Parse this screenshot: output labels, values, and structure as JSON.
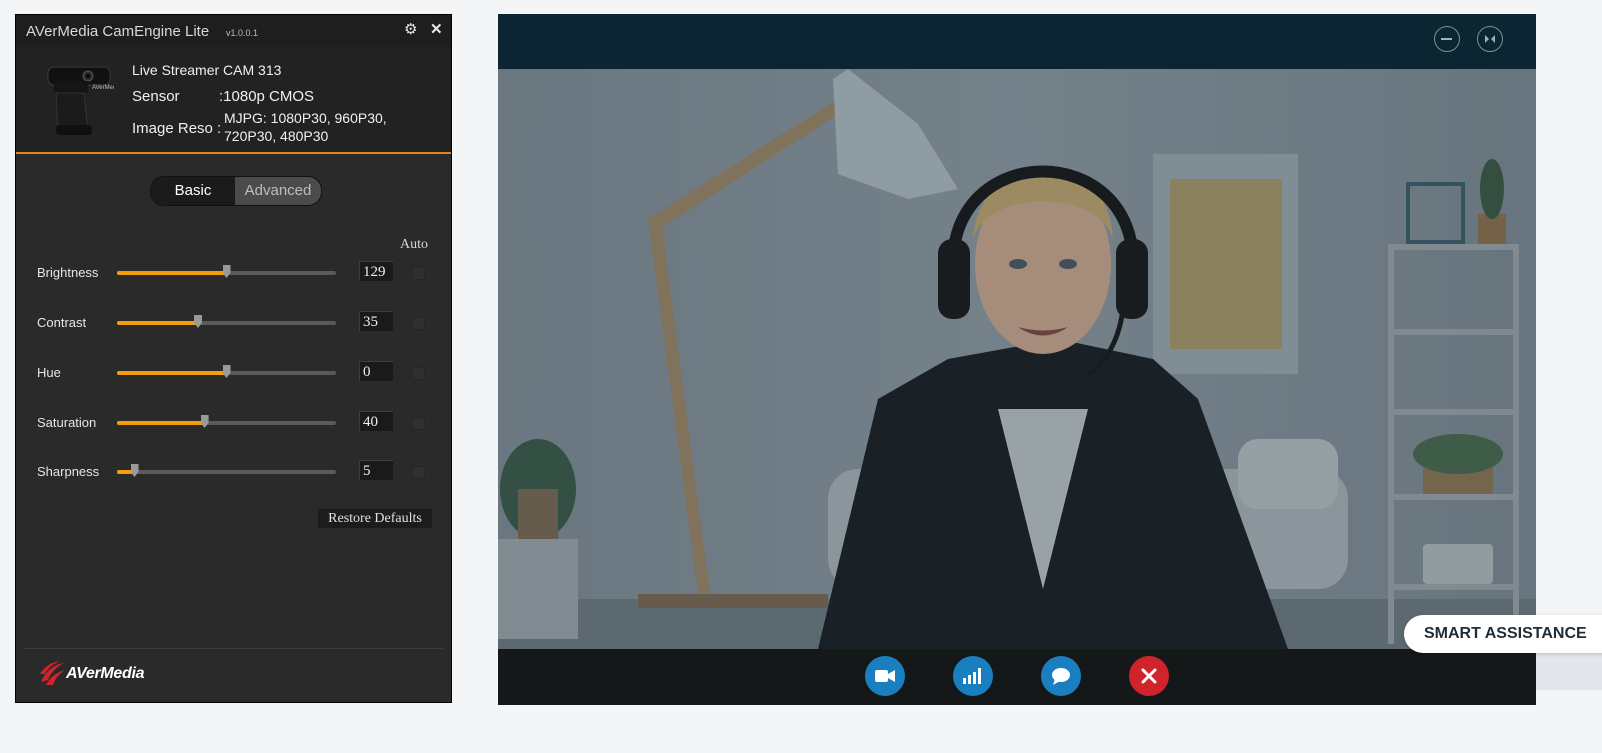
{
  "app": {
    "title": "AVerMedia CamEngine Lite",
    "version": "v1.0.0.1"
  },
  "device": {
    "name": "Live Streamer CAM 313",
    "sensor_label": "Sensor",
    "sensor_value": ":1080p CMOS",
    "reso_label": "Image Reso :",
    "reso_line1": "MJPG: 1080P30, 960P30,",
    "reso_line2": "720P30, 480P30"
  },
  "tabs": {
    "basic": "Basic",
    "advanced": "Advanced",
    "active": "Basic"
  },
  "auto_label": "Auto",
  "sliders": [
    {
      "label": "Brightness",
      "value": "129",
      "fraction": 0.5
    },
    {
      "label": "Contrast",
      "value": "35",
      "fraction": 0.37
    },
    {
      "label": "Hue",
      "value": "0",
      "fraction": 0.5
    },
    {
      "label": "Saturation",
      "value": "40",
      "fraction": 0.4
    },
    {
      "label": "Sharpness",
      "value": "5",
      "fraction": 0.08
    }
  ],
  "restore_label": "Restore Defaults",
  "brand": "AVerMedia",
  "smart_assist": "SMART ASSISTANCE",
  "colors": {
    "accent": "#f39c12",
    "panel": "#2a2a2a",
    "video_bar": "#0b2533",
    "call_blue": "#1a7fc1",
    "hangup_red": "#d0232b"
  },
  "icons": {
    "title_bar": [
      "gear-icon",
      "close-icon"
    ],
    "video_top": [
      "minimize-icon",
      "collapse-icon"
    ],
    "call_controls": [
      "video-camera-icon",
      "signal-bars-icon",
      "chat-bubble-icon",
      "hangup-icon"
    ]
  }
}
